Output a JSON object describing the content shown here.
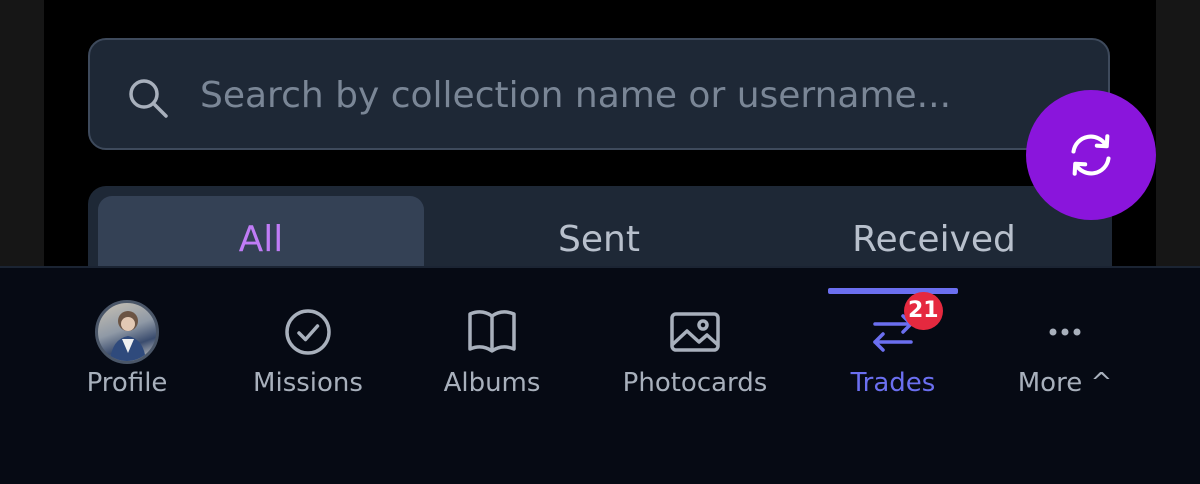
{
  "search": {
    "placeholder": "Search by collection name or username..."
  },
  "tabs": [
    {
      "label": "All",
      "active": true
    },
    {
      "label": "Sent",
      "active": false
    },
    {
      "label": "Received",
      "active": false
    }
  ],
  "fab": {
    "icon": "refresh-icon",
    "color": "#8a15dc"
  },
  "nav": {
    "items": [
      {
        "label": "Profile",
        "icon": "avatar"
      },
      {
        "label": "Missions",
        "icon": "check-circle-icon"
      },
      {
        "label": "Albums",
        "icon": "book-icon"
      },
      {
        "label": "Photocards",
        "icon": "image-icon"
      },
      {
        "label": "Trades",
        "icon": "swap-icon",
        "active": true,
        "badge": "21"
      },
      {
        "label": "More ^",
        "icon": "more-dots-icon"
      }
    ],
    "active_color": "#6b6ff0",
    "badge_color": "#e5293f"
  }
}
